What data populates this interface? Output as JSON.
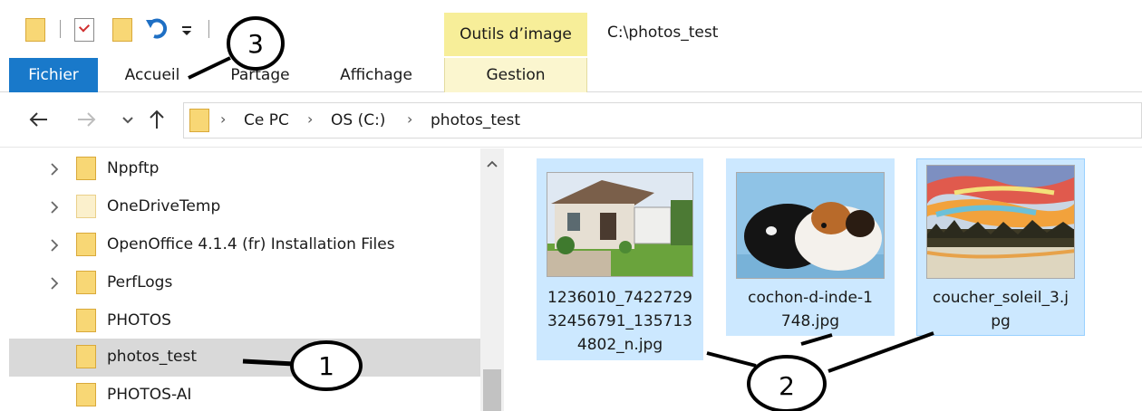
{
  "quick_access": {
    "icons": [
      "folder-icon",
      "properties-icon",
      "new-folder-icon",
      "undo-icon",
      "customize-dropdown-icon"
    ]
  },
  "contextual_tab": {
    "group_label": "Outils d’image",
    "tab_label": "Gestion",
    "color": "#f7ee99"
  },
  "window": {
    "title_path": "C:\\photos_test"
  },
  "ribbon": {
    "tabs": [
      {
        "label": "Fichier",
        "accent": "#1979ca"
      },
      {
        "label": "Accueil"
      },
      {
        "label": "Partage"
      },
      {
        "label": "Affichage"
      }
    ]
  },
  "address_bar": {
    "breadcrumbs": [
      "Ce PC",
      "OS (C:)",
      "photos_test"
    ],
    "separator": "›"
  },
  "nav_pane": {
    "items": [
      {
        "label": "Nppftp",
        "expandable": true,
        "selected": false
      },
      {
        "label": "OneDriveTemp",
        "expandable": true,
        "selected": false,
        "pale": true
      },
      {
        "label": "OpenOffice 4.1.4 (fr) Installation Files",
        "expandable": true,
        "selected": false
      },
      {
        "label": "PerfLogs",
        "expandable": true,
        "selected": false
      },
      {
        "label": "PHOTOS",
        "expandable": false,
        "selected": false
      },
      {
        "label": "photos_test",
        "expandable": false,
        "selected": true
      },
      {
        "label": "PHOTOS-AI",
        "expandable": false,
        "selected": false
      }
    ]
  },
  "files": [
    {
      "name": "1236010_7422729\n32456791_135713\n4802_n.jpg",
      "thumbnail": "house-photo"
    },
    {
      "name": "cochon-d-inde-1\n748.jpg",
      "thumbnail": "guinea-pig-photo"
    },
    {
      "name": "coucher_soleil_3.j\npg",
      "thumbnail": "sunset-painting"
    }
  ],
  "annotations": [
    {
      "number": "1"
    },
    {
      "number": "2"
    },
    {
      "number": "3"
    }
  ],
  "colors": {
    "selection": "#cce8ff",
    "selection_border": "#99d1ff",
    "nav_selected": "#d9d9d9",
    "folder": "#f8d775"
  }
}
